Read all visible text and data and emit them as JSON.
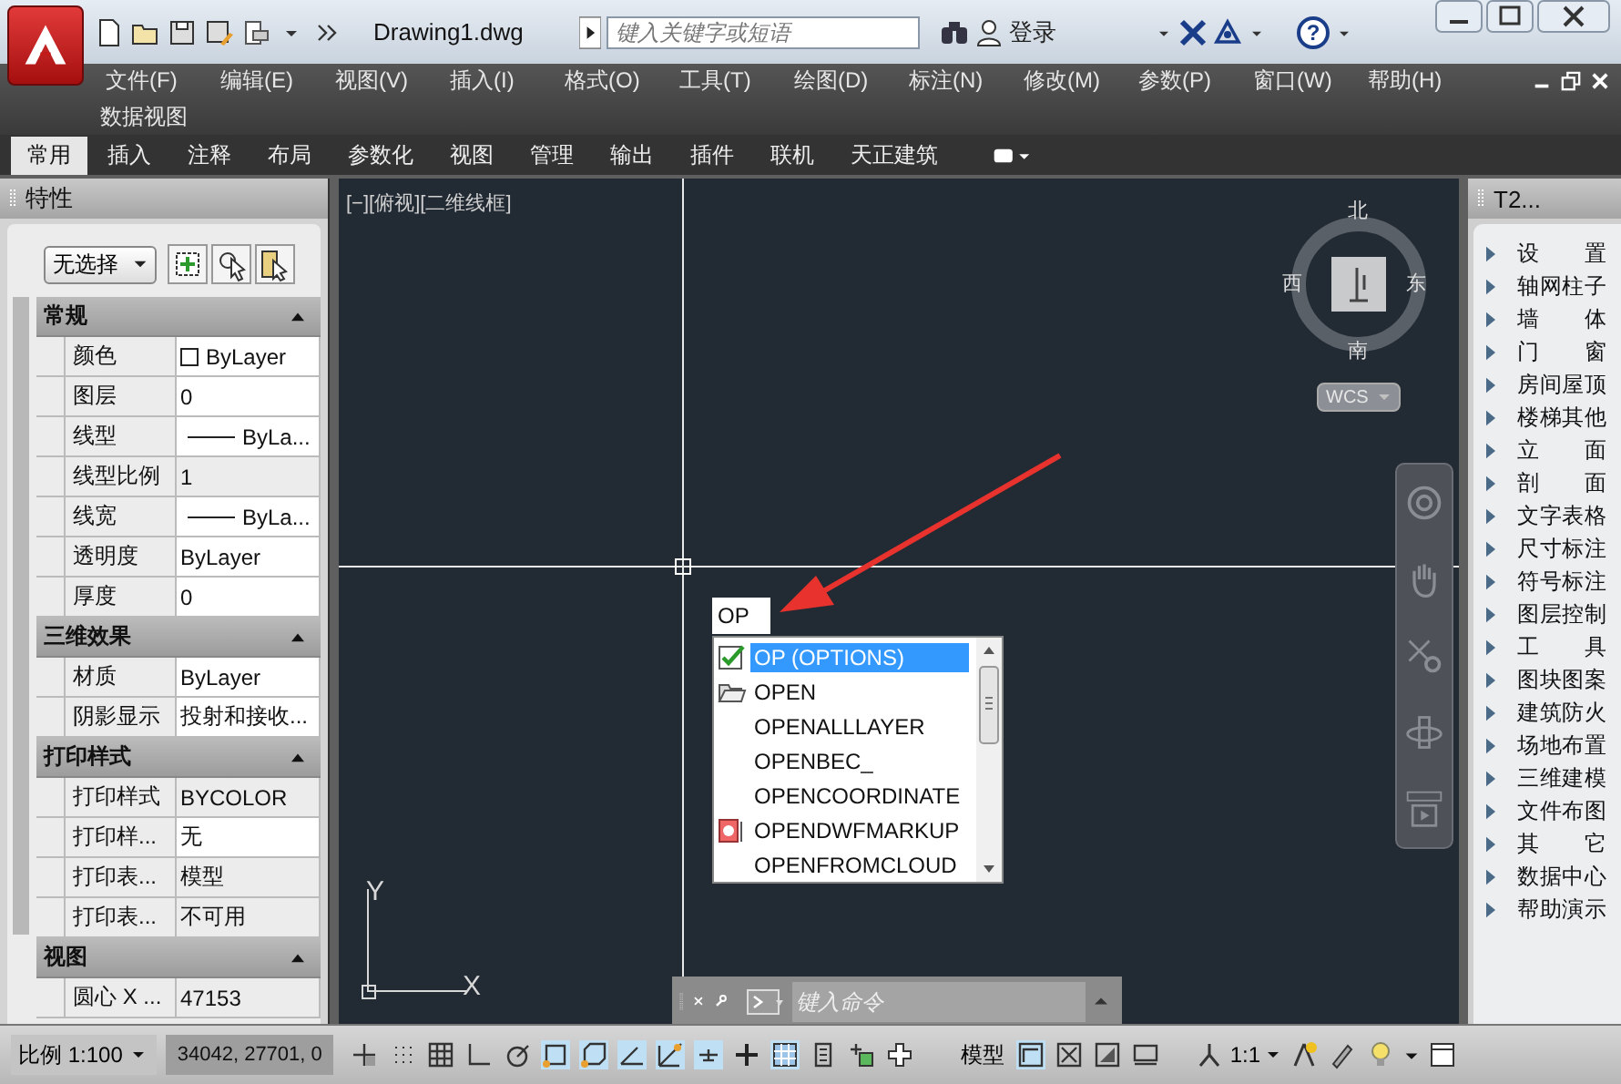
{
  "title_bar": {
    "document_tab": "Drawing1.dwg",
    "search": {
      "placeholder": "键入关键字或短语"
    },
    "sign_in": "登录",
    "help": "?"
  },
  "menu": [
    "文件(F)",
    "编辑(E)",
    "视图(V)",
    "插入(I)",
    "格式(O)",
    "工具(T)",
    "绘图(D)",
    "标注(N)",
    "修改(M)",
    "参数(P)",
    "窗口(W)",
    "帮助(H)"
  ],
  "menu_row2": [
    "数据视图"
  ],
  "ribbon_tabs": [
    {
      "label": "常用",
      "selected": true
    },
    {
      "label": "插入",
      "selected": false
    },
    {
      "label": "注释",
      "selected": false
    },
    {
      "label": "布局",
      "selected": false
    },
    {
      "label": "参数化",
      "selected": false
    },
    {
      "label": "视图",
      "selected": false
    },
    {
      "label": "管理",
      "selected": false
    },
    {
      "label": "输出",
      "selected": false
    },
    {
      "label": "插件",
      "selected": false
    },
    {
      "label": "联机",
      "selected": false
    },
    {
      "label": "天正建筑",
      "selected": false
    }
  ],
  "properties": {
    "title": "特性",
    "selection": "无选择",
    "sections": [
      {
        "title": "常规",
        "expanded": true,
        "rows": [
          {
            "label": "颜色",
            "value": "ByLayer",
            "kind": "color",
            "readonly": false
          },
          {
            "label": "图层",
            "value": "0",
            "kind": "text",
            "readonly": false
          },
          {
            "label": "线型",
            "value": "ByLa...",
            "kind": "line",
            "readonly": false
          },
          {
            "label": "线型比例",
            "value": "1",
            "kind": "text",
            "readonly": true
          },
          {
            "label": "线宽",
            "value": "ByLa...",
            "kind": "line",
            "readonly": false
          },
          {
            "label": "透明度",
            "value": "ByLayer",
            "kind": "text",
            "readonly": false
          },
          {
            "label": "厚度",
            "value": "0",
            "kind": "text",
            "readonly": false
          }
        ]
      },
      {
        "title": "三维效果",
        "expanded": true,
        "rows": [
          {
            "label": "材质",
            "value": "ByLayer",
            "kind": "text",
            "readonly": false
          },
          {
            "label": "阴影显示",
            "value": "投射和接收...",
            "kind": "text",
            "readonly": false
          }
        ]
      },
      {
        "title": "打印样式",
        "expanded": true,
        "rows": [
          {
            "label": "打印样式",
            "value": "BYCOLOR",
            "kind": "text",
            "readonly": true
          },
          {
            "label": "打印样...",
            "value": "无",
            "kind": "text",
            "readonly": false
          },
          {
            "label": "打印表...",
            "value": "模型",
            "kind": "text",
            "readonly": true
          },
          {
            "label": "打印表...",
            "value": "不可用",
            "kind": "text",
            "readonly": true
          }
        ]
      },
      {
        "title": "视图",
        "expanded": true,
        "rows": [
          {
            "label": "圆心 X ...",
            "value": "47153",
            "kind": "text",
            "readonly": true
          }
        ]
      }
    ]
  },
  "viewport": {
    "label": "[−][俯视][二维线框]",
    "compass": {
      "north": "北",
      "west": "西",
      "east": "东",
      "south": "南"
    },
    "ucs_label": "WCS",
    "axes": {
      "x": "X",
      "y": "Y"
    },
    "command_input": {
      "value": "OP"
    },
    "autocomplete": [
      {
        "label": "OP (OPTIONS)",
        "selected": true,
        "kind": "check"
      },
      {
        "label": "OPEN",
        "selected": false,
        "kind": "folder"
      },
      {
        "label": "OPENALLLAYER",
        "selected": false,
        "kind": "plain"
      },
      {
        "label": "OPENBEC_",
        "selected": false,
        "kind": "plain"
      },
      {
        "label": "OPENCOORDINATE",
        "selected": false,
        "kind": "plain"
      },
      {
        "label": "OPENDWFMARKUP",
        "selected": false,
        "kind": "markup"
      },
      {
        "label": "OPENFROMCLOUD",
        "selected": false,
        "kind": "plain"
      }
    ],
    "command_line": {
      "placeholder": "键入命令"
    }
  },
  "tool_palette": {
    "title": "T2...",
    "items": [
      "设 置",
      "轴网柱子",
      "墙 体",
      "门 窗",
      "房间屋顶",
      "楼梯其他",
      "立 面",
      "剖 面",
      "文字表格",
      "尺寸标注",
      "符号标注",
      "图层控制",
      "工 具",
      "图块图案",
      "建筑防火",
      "场地布置",
      "三维建模",
      "文件布图",
      "其 它",
      "数据中心",
      "帮助演示"
    ]
  },
  "status_bar": {
    "scale": "比例 1:100",
    "coordinates": "34042, 27701, 0",
    "model": "模型",
    "annotation_scale": "1:1",
    "toggles": [
      {
        "on": false
      },
      {
        "on": false
      },
      {
        "on": false
      },
      {
        "on": false
      },
      {
        "on": false
      },
      {
        "on": true
      },
      {
        "on": true
      },
      {
        "on": true
      },
      {
        "on": true
      },
      {
        "on": true
      },
      {
        "on": false
      },
      {
        "on": true
      },
      {
        "on": false
      },
      {
        "on": false
      },
      {
        "on": false
      }
    ],
    "layout_toggles": [
      {
        "on": true
      },
      {
        "on": false
      },
      {
        "on": false
      },
      {
        "on": false
      }
    ]
  }
}
